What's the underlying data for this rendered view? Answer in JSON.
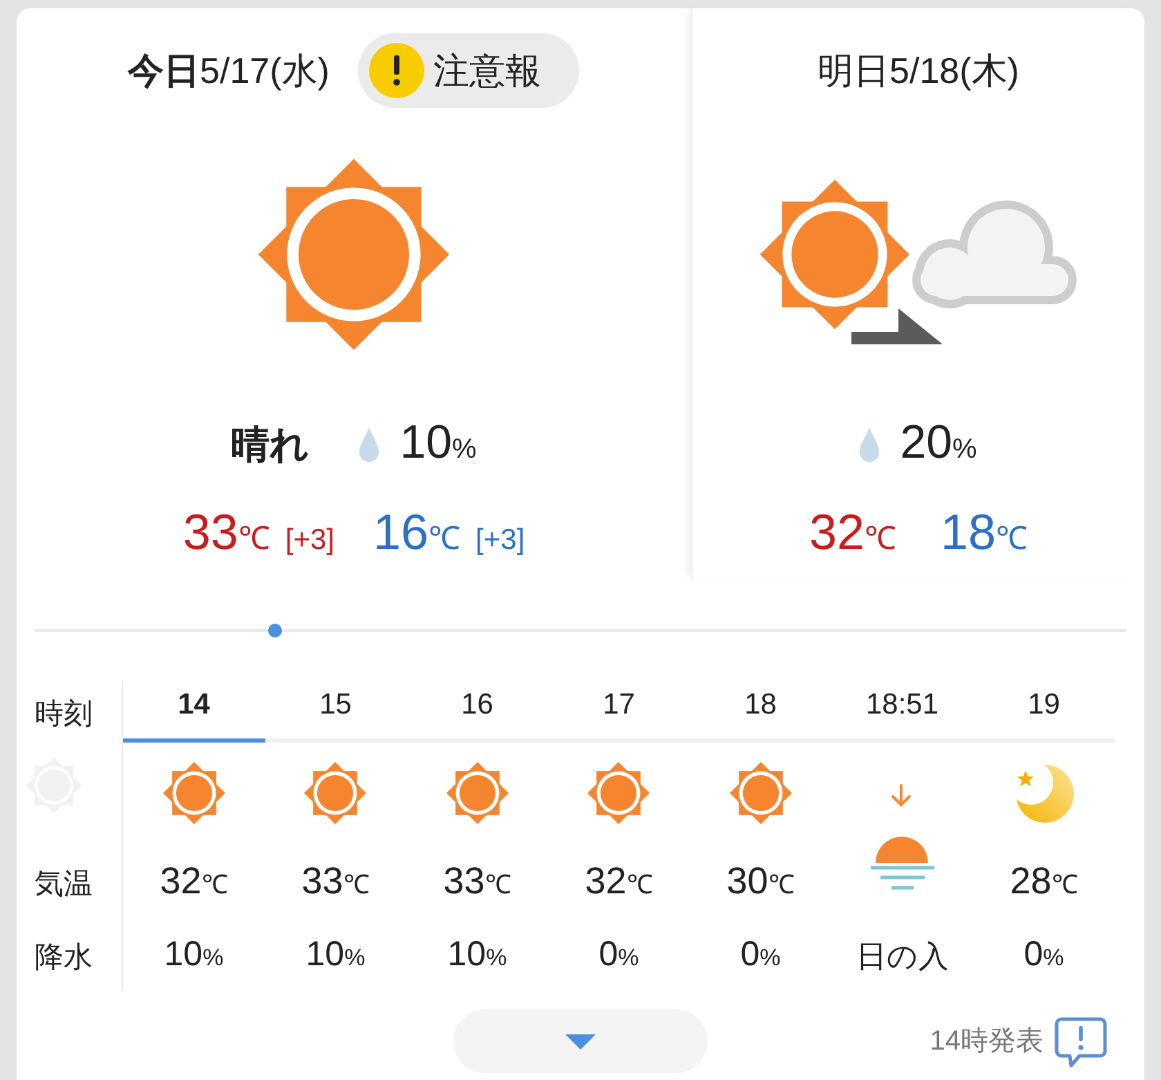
{
  "days": [
    {
      "kind": "sun",
      "title": "**今日**5/17(水)",
      "warning": "注意報",
      "weather": "晴れ",
      "precip": {
        "value": "10",
        "unit": "%"
      },
      "high": {
        "value": "33",
        "unit": "℃",
        "diff": "[+3]"
      },
      "low": {
        "value": "16",
        "unit": "℃",
        "diff": "[+3]"
      }
    },
    {
      "kind": "sun_then_cloud",
      "title": "明日5/18(木)",
      "precip": {
        "value": "20",
        "unit": "%"
      },
      "high": {
        "value": "32",
        "unit": "℃"
      },
      "low": {
        "value": "18",
        "unit": "℃"
      }
    }
  ],
  "timeline": {
    "level": 0.22
  },
  "hourly": {
    "labels": {
      "time": "時刻",
      "temp": "気温",
      "precip": "降水"
    },
    "hours": [
      {
        "time": "14",
        "selected": true,
        "kind": "sun",
        "temp": {
          "value": "32",
          "unit": "℃"
        },
        "precip": {
          "value": "10",
          "unit": "%"
        }
      },
      {
        "time": "15",
        "selected": false,
        "kind": "sun",
        "temp": {
          "value": "33",
          "unit": "℃"
        },
        "precip": {
          "value": "10",
          "unit": "%"
        }
      },
      {
        "time": "16",
        "selected": false,
        "kind": "sun",
        "temp": {
          "value": "33",
          "unit": "℃"
        },
        "precip": {
          "value": "10",
          "unit": "%"
        }
      },
      {
        "time": "17",
        "selected": false,
        "kind": "sun",
        "temp": {
          "value": "32",
          "unit": "℃"
        },
        "precip": {
          "value": "0",
          "unit": "%"
        }
      },
      {
        "time": "18",
        "selected": false,
        "kind": "sun",
        "temp": {
          "value": "30",
          "unit": "℃"
        },
        "precip": {
          "value": "0",
          "unit": "%"
        }
      },
      {
        "time": "18:51",
        "selected": false,
        "kind": "sunset",
        "event": "日の入"
      },
      {
        "time": "19",
        "selected": false,
        "kind": "moon",
        "temp": {
          "value": "28",
          "unit": "℃"
        },
        "precip": {
          "value": "0",
          "unit": "%"
        }
      }
    ]
  },
  "footer": {
    "issued": "14時発表"
  }
}
